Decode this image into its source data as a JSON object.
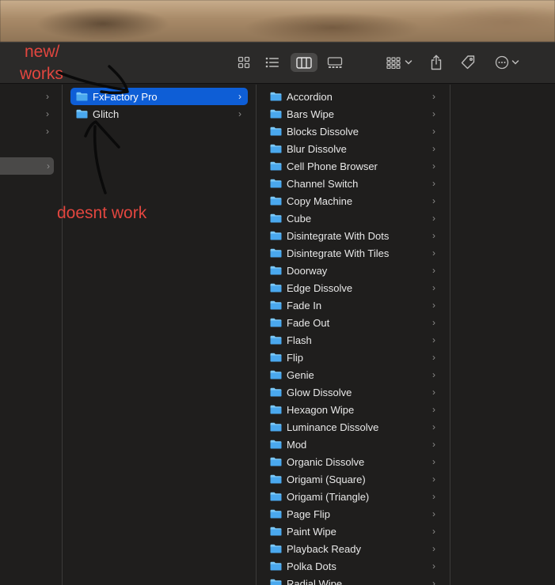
{
  "annotations": {
    "works_line1": "new/",
    "works_line2": "works",
    "doesnt_work": "doesnt work"
  },
  "toolbar": {
    "view_modes": [
      "icon-view",
      "list-view",
      "column-view",
      "gallery-view"
    ],
    "active_view": "column-view",
    "buttons": [
      "group-by",
      "share",
      "tags",
      "more-actions"
    ]
  },
  "column2": {
    "items": [
      {
        "label": "FxFactory Pro",
        "selected": true
      },
      {
        "label": "Glitch",
        "selected": false
      }
    ]
  },
  "column3": {
    "items": [
      "Accordion",
      "Bars Wipe",
      "Blocks Dissolve",
      "Blur Dissolve",
      "Cell Phone Browser",
      "Channel Switch",
      "Copy Machine",
      "Cube",
      "Disintegrate With Dots",
      "Disintegrate With Tiles",
      "Doorway",
      "Edge Dissolve",
      "Fade In",
      "Fade Out",
      "Flash",
      "Flip",
      "Genie",
      "Glow Dissolve",
      "Hexagon Wipe",
      "Luminance Dissolve",
      "Mod",
      "Organic Dissolve",
      "Origami (Square)",
      "Origami (Triangle)",
      "Page Flip",
      "Paint Wipe",
      "Playback Ready",
      "Polka Dots",
      "Radial Wipe"
    ]
  },
  "colors": {
    "selection": "#0e5ed6",
    "annotation": "#e2463f",
    "folder": "#5ab8f5"
  }
}
